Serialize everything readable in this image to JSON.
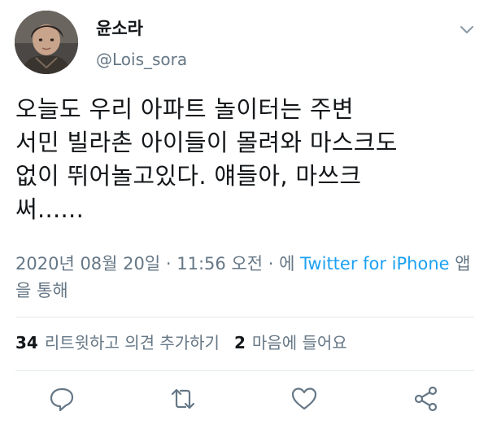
{
  "user": {
    "display_name": "윤소라",
    "handle": "@Lois_sora"
  },
  "tweet": {
    "text": "오늘도 우리 아파트 놀이터는 주변\n서민 빌라촌 아이들이 몰려와 마스크도\n없이 뛰어놀고있다. 얘들아, 마쓰크\n써......"
  },
  "meta": {
    "timestamp": "2020년 08월 20일 · 11:56 오전 · 에 ",
    "source_app": "Twitter for iPhone",
    "source_suffix": " 앱을 통해"
  },
  "stats": {
    "retweets_count": "34",
    "retweets_label": "리트윗하고 의견 추가하기",
    "likes_count": "2",
    "likes_label": "마음에 들어요"
  },
  "icons": {
    "menu": "chevron-down-icon",
    "reply": "reply-icon",
    "retweet": "retweet-icon",
    "like": "heart-icon",
    "share": "share-icon"
  },
  "colors": {
    "text": "#14171a",
    "secondary": "#657786",
    "link": "#1da1f2",
    "divider": "#e1e8ed"
  }
}
